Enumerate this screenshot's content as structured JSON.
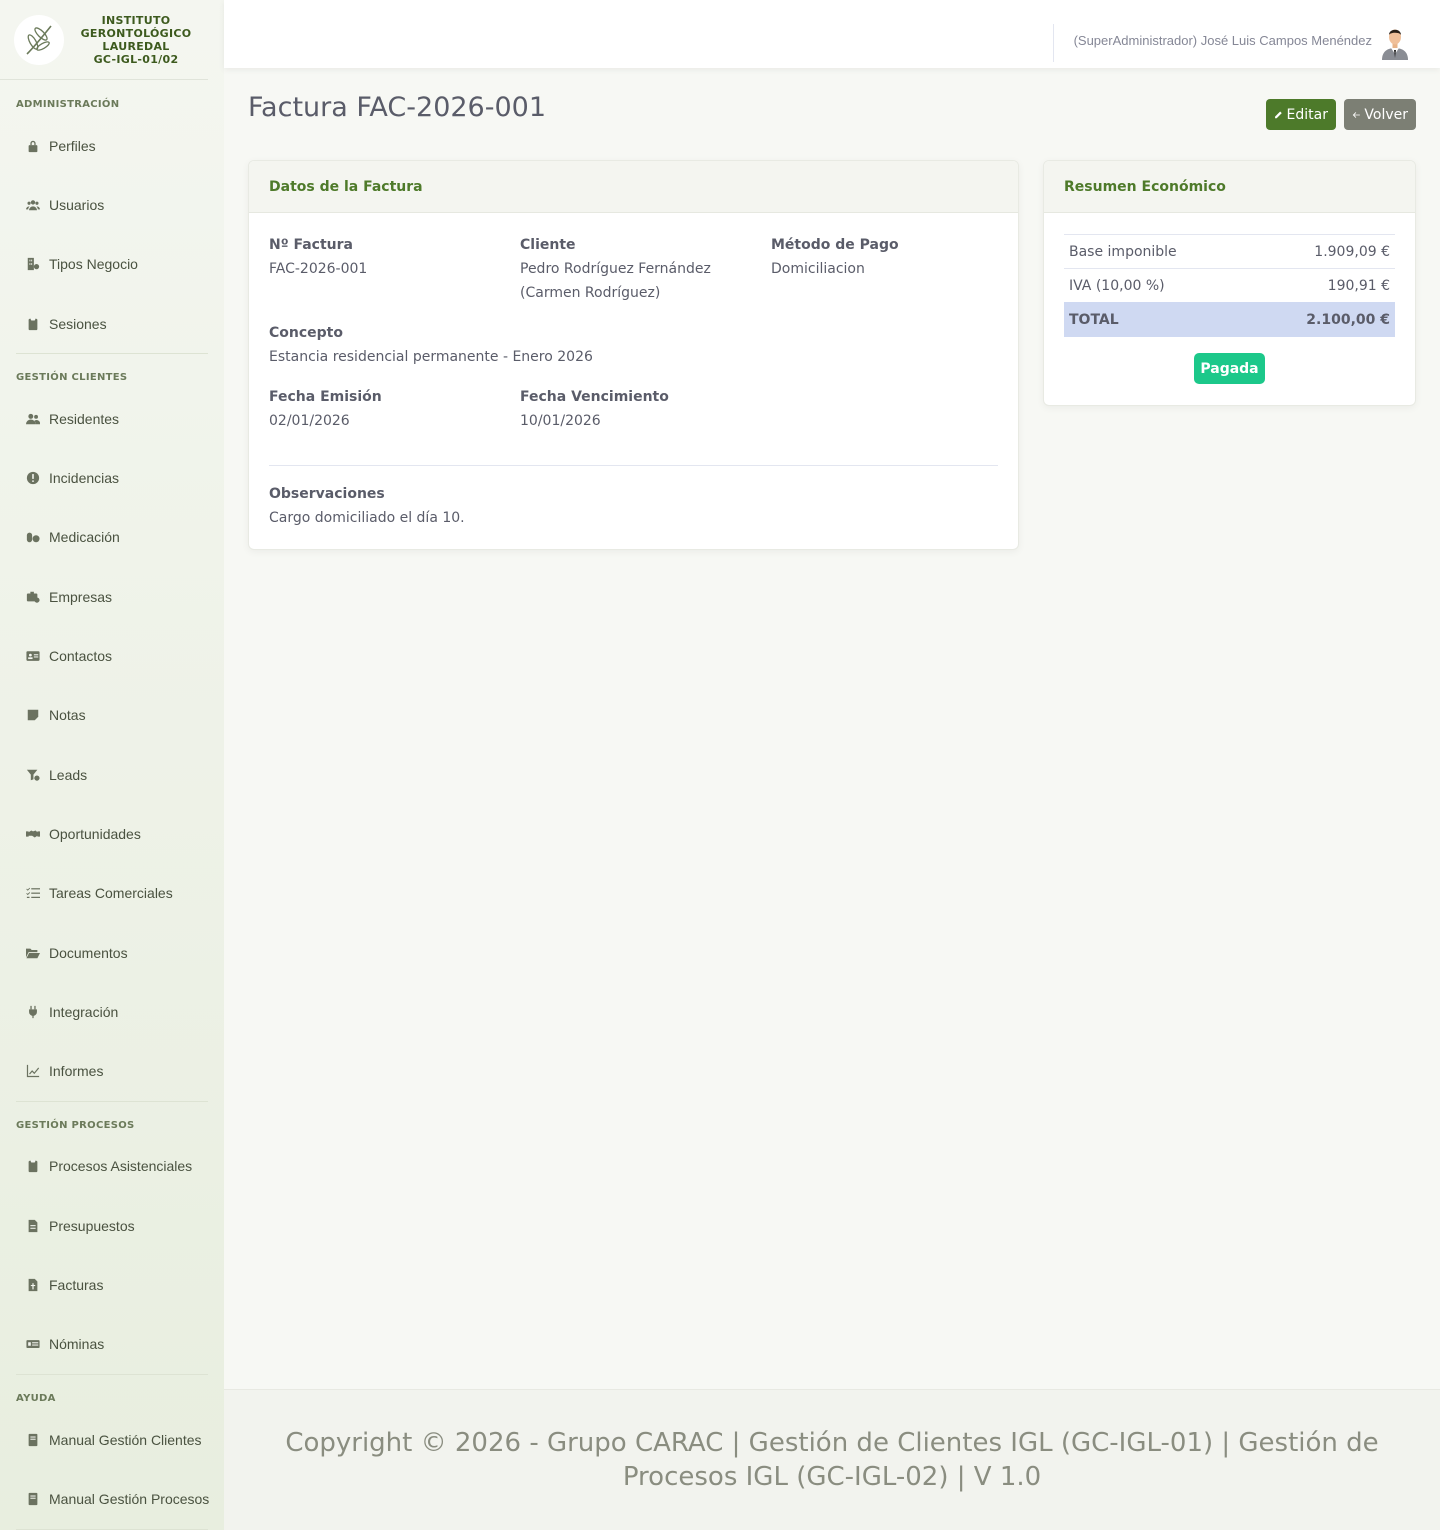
{
  "brand": {
    "line1": "INSTITUTO",
    "line2": "GERONTOLÓGICO",
    "line3": "LAUREDAL",
    "line4": "GC-IGL-01/02",
    "logo_icon": "olive-branch-icon"
  },
  "sidebar": {
    "sections": [
      {
        "heading": "ADMINISTRACIÓN",
        "items": [
          {
            "label": "Perfiles",
            "icon": "lock-icon"
          },
          {
            "label": "Usuarios",
            "icon": "users-icon"
          },
          {
            "label": "Tipos Negocio",
            "icon": "building-icon"
          },
          {
            "label": "Sesiones",
            "icon": "clipboard-icon"
          }
        ]
      },
      {
        "heading": "GESTIÓN CLIENTES",
        "items": [
          {
            "label": "Residentes",
            "icon": "user-group-icon"
          },
          {
            "label": "Incidencias",
            "icon": "exclamation-icon"
          },
          {
            "label": "Medicación",
            "icon": "pills-icon"
          },
          {
            "label": "Empresas",
            "icon": "briefcase-icon"
          },
          {
            "label": "Contactos",
            "icon": "address-card-icon"
          },
          {
            "label": "Notas",
            "icon": "note-icon"
          },
          {
            "label": "Leads",
            "icon": "funnel-icon"
          },
          {
            "label": "Oportunidades",
            "icon": "handshake-icon"
          },
          {
            "label": "Tareas Comerciales",
            "icon": "list-check-icon"
          },
          {
            "label": "Documentos",
            "icon": "folder-open-icon"
          },
          {
            "label": "Integración",
            "icon": "plug-icon"
          },
          {
            "label": "Informes",
            "icon": "line-chart-icon"
          }
        ]
      },
      {
        "heading": "GESTIÓN PROCESOS",
        "items": [
          {
            "label": "Procesos Asistenciales",
            "icon": "clipboard-icon"
          },
          {
            "label": "Presupuestos",
            "icon": "file-icon"
          },
          {
            "label": "Facturas",
            "icon": "invoice-icon"
          },
          {
            "label": "Nóminas",
            "icon": "money-icon"
          }
        ]
      },
      {
        "heading": "AYUDA",
        "items": [
          {
            "label": "Manual Gestión Clientes",
            "icon": "book-icon"
          },
          {
            "label": "Manual Gestión Procesos",
            "icon": "book-icon"
          }
        ]
      }
    ]
  },
  "topbar": {
    "user_name": "(SuperAdministrador) José Luis Campos Menéndez"
  },
  "page": {
    "title": "Factura FAC-2026-001",
    "edit_label": "Editar",
    "back_label": "Volver"
  },
  "invoice": {
    "header": "Datos de la Factura",
    "number_label": "Nº Factura",
    "number": "FAC-2026-001",
    "client_label": "Cliente",
    "client_line1": "Pedro Rodríguez Fernández",
    "client_line2": "(Carmen Rodríguez)",
    "payment_label": "Método de Pago",
    "payment": "Domiciliacion",
    "concept_label": "Concepto",
    "concept": "Estancia residencial permanente - Enero 2026",
    "issue_label": "Fecha Emisión",
    "issue_date": "02/01/2026",
    "due_label": "Fecha Vencimiento",
    "due_date": "10/01/2026",
    "notes_label": "Observaciones",
    "notes": "Cargo domiciliado el día 10."
  },
  "summary": {
    "header": "Resumen Económico",
    "base_label": "Base imponible",
    "base_value": "1.909,09 €",
    "vat_label": "IVA (10,00 %)",
    "vat_value": "190,91 €",
    "total_label": "TOTAL",
    "total_value": "2.100,00 €",
    "status": "Pagada",
    "status_color": "#1cc88a"
  },
  "footer": {
    "text": "Copyright © 2026 - Grupo CARAC | Gestión de Clientes IGL (GC-IGL-01) | Gestión de Procesos IGL (GC-IGL-02) | V 1.0"
  }
}
